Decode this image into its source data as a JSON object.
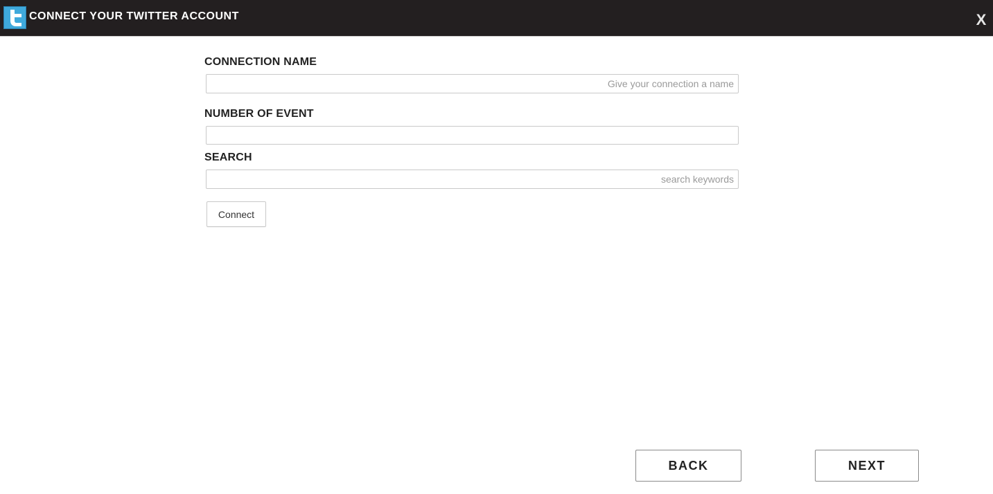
{
  "header": {
    "title": "CONNECT YOUR TWITTER ACCOUNT",
    "close_label": "X",
    "logo_icon": "twitter-icon",
    "background_color": "#231f20",
    "logo_color": "#3fa9dc"
  },
  "form": {
    "connection_name": {
      "label": "CONNECTION NAME",
      "value": "",
      "placeholder": "Give your connection a name"
    },
    "number_of_event": {
      "label": "NUMBER OF EVENT",
      "value": "",
      "placeholder": ""
    },
    "search": {
      "label": "SEARCH",
      "value": "",
      "placeholder": "search keywords"
    },
    "connect_label": "Connect"
  },
  "footer": {
    "back_label": "BACK",
    "next_label": "NEXT"
  }
}
